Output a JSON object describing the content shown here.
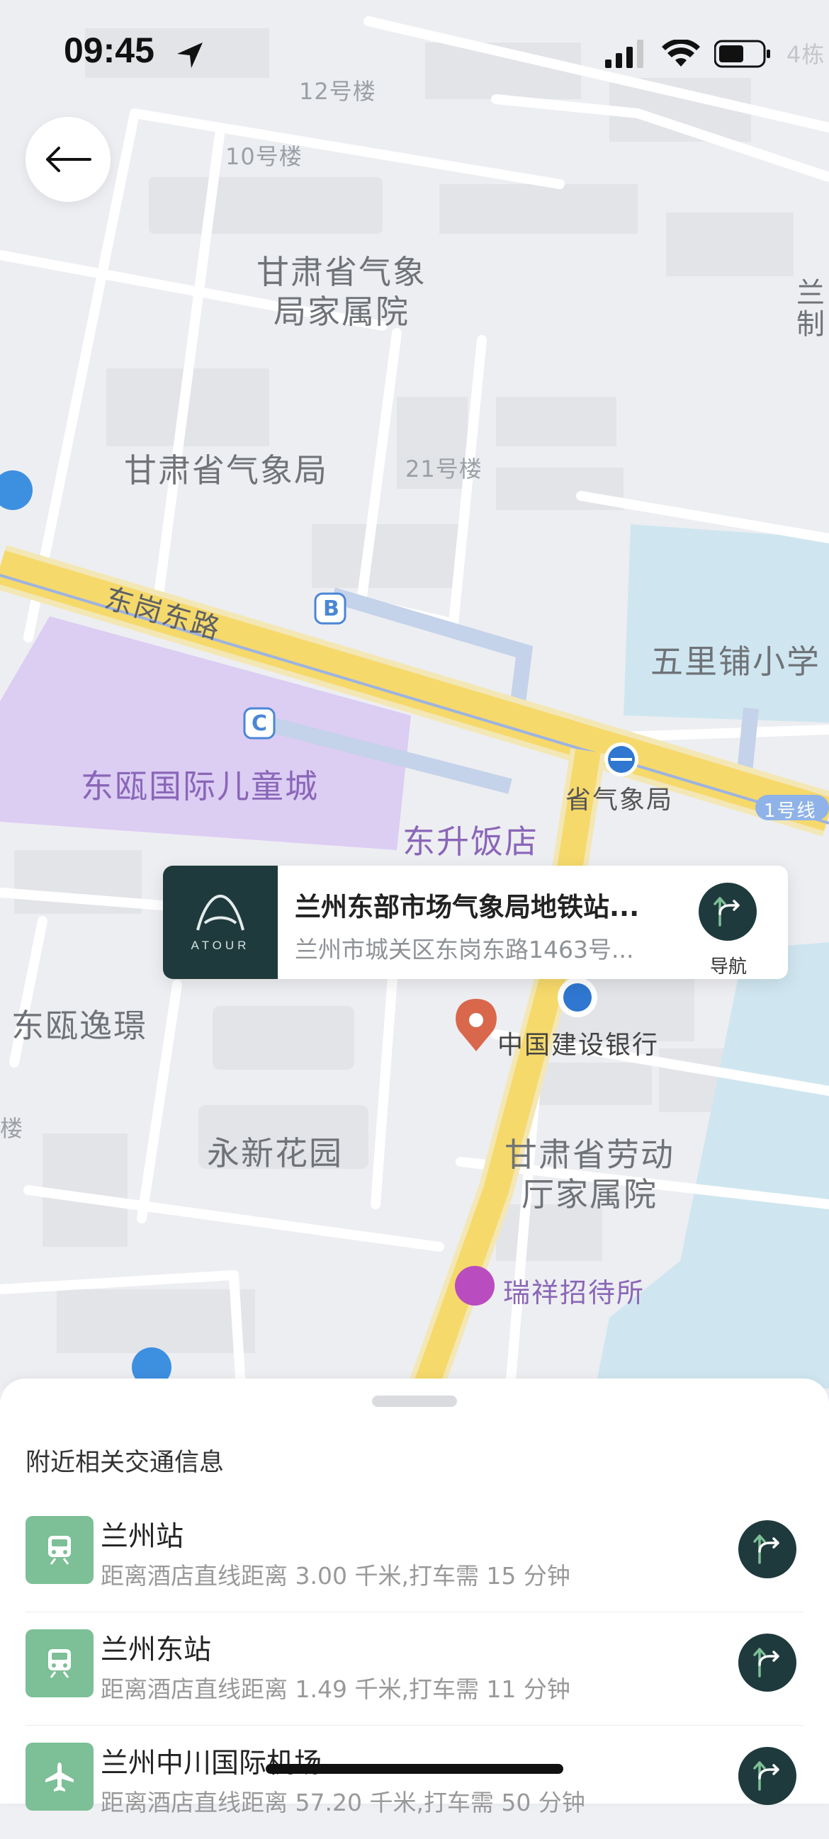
{
  "status_bar": {
    "time": "09:45"
  },
  "map": {
    "labels": {
      "bldg_12": "12号楼",
      "bldg_10": "10号楼",
      "bldg_4": "4栋",
      "weather_housing_1": "甘肃省气象",
      "weather_housing_2": "局家属院",
      "weather_bureau": "甘肃省气象局",
      "bldg_21": "21号楼",
      "road_donggang": "东岗东路",
      "wuli_school": "五里铺小学",
      "dongou_city": "东瓯国际儿童城",
      "dongsheng_hotel": "东升饭店",
      "metro_station": "省气象局",
      "line1": "1号线",
      "dongou_yijing": "东瓯逸璟",
      "ccb": "中国建设银行",
      "yongxin": "永新花园",
      "labor_housing_1": "甘肃省劳动",
      "labor_housing_2": "厅家属院",
      "ruixiang": "瑞祥招待所",
      "bldg_edge": "楼",
      "stop_b": "B",
      "stop_c": "C",
      "edge_right_1": "兰",
      "edge_right_2": "制"
    }
  },
  "hotel_card": {
    "brand": "ATOUR",
    "name": "兰州东部市场气象局地铁站...",
    "address": "兰州市城关区东岗东路1463号...",
    "nav_label": "导航"
  },
  "sheet": {
    "title": "附近相关交通信息",
    "items": [
      {
        "name": "兰州站",
        "desc": "距离酒店直线距离 3.00 千米,打车需 15 分钟",
        "icon": "train-icon"
      },
      {
        "name": "兰州东站",
        "desc": "距离酒店直线距离 1.49 千米,打车需 11 分钟",
        "icon": "train-icon"
      },
      {
        "name": "兰州中川国际机场",
        "desc": "距离酒店直线距离 57.20 千米,打车需 50 分钟",
        "icon": "plane-icon"
      }
    ]
  },
  "colors": {
    "brand_dark": "#1f3a3c",
    "transit_green": "#7dbf96",
    "road_yellow": "#f6d96b",
    "poi_purple": "#dccdf3"
  }
}
